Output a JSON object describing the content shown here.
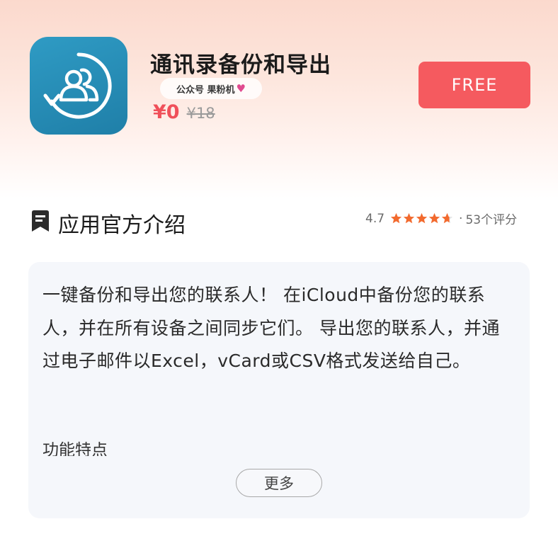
{
  "app": {
    "name": "通讯录备份和导出",
    "watermark": "公众号 果粉机",
    "watermark_icon": "heart-icon",
    "price": "¥0",
    "original_price": "¥18",
    "action_label": "FREE",
    "icon": "contacts-backup-icon"
  },
  "section": {
    "icon": "book-icon",
    "title": "应用官方介绍",
    "rating_score": "4.7",
    "rating_stars": 4.7,
    "rating_separator": "·",
    "rating_count": "53个评分"
  },
  "description": {
    "text": "一键备份和导出您的联系人！ 在iCloud中备份您的联系人，并在所有设备之间同步它们。 导出您的联系人，并通过电子邮件以Excel，vCard或CSV格式发送给自己。",
    "feature_heading": "功能特点",
    "more_label": "更多"
  },
  "colors": {
    "accent": "#f55a5f",
    "star": "#f26a2e",
    "icon_bg": "#2389b5"
  }
}
